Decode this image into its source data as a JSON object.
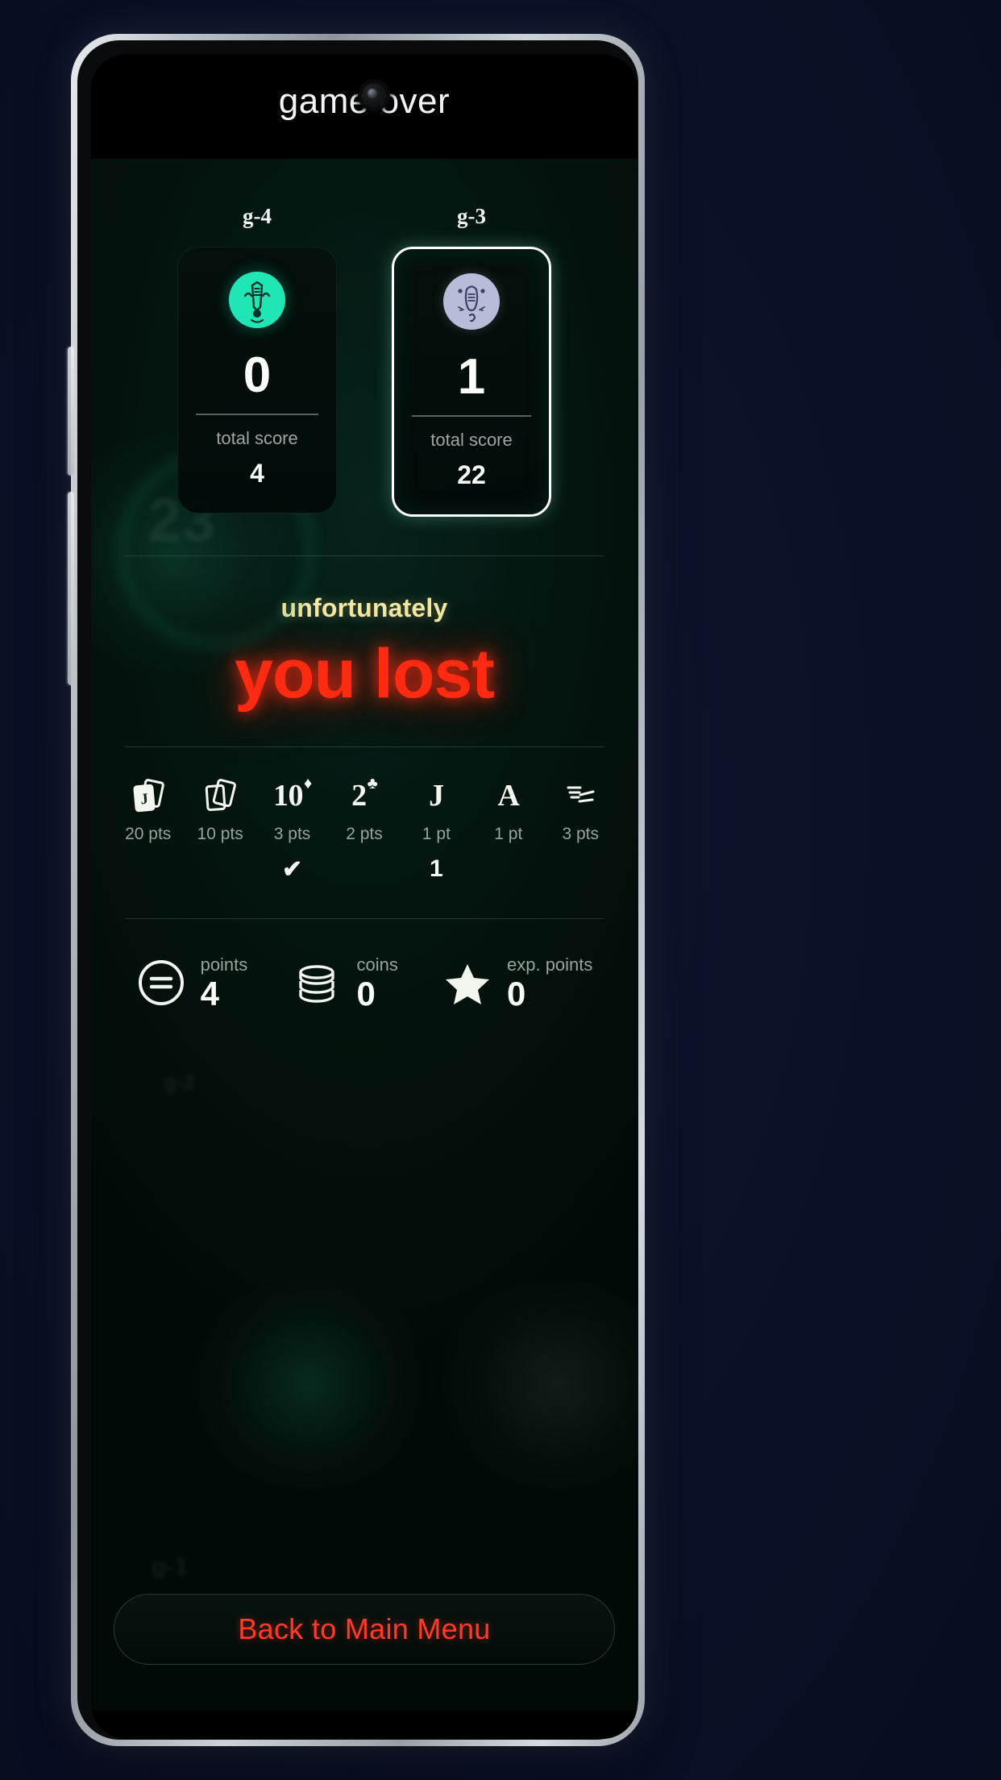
{
  "app": {
    "title": "game over",
    "camera_icon": "front-camera-cutout"
  },
  "players": [
    {
      "name": "g-4",
      "avatar_icon": "avatar-face-teal",
      "avatar_color": "#1FE6B4",
      "round_score": "0",
      "total_score_label": "total score",
      "total_score": "4",
      "active": false
    },
    {
      "name": "g-3",
      "avatar_icon": "avatar-face-lilac",
      "avatar_color": "#B9BCD8",
      "round_score": "1",
      "total_score_label": "total score",
      "total_score": "22",
      "active": true
    }
  ],
  "result": {
    "subtitle": "unfortunately",
    "headline": "you lost",
    "subtitle_color": "#F2E9A3",
    "headline_color": "#FF2A12"
  },
  "legend": {
    "columns": [
      {
        "icon": "two-cards-jack-icon",
        "rank": "",
        "suit": "",
        "points": "20 pts",
        "mark": ""
      },
      {
        "icon": "two-cards-blank-icon",
        "rank": "",
        "suit": "",
        "points": "10 pts",
        "mark": ""
      },
      {
        "icon": "card-rank-icon",
        "rank": "10",
        "suit": "♦",
        "points": "3 pts",
        "mark": "✔"
      },
      {
        "icon": "card-rank-icon",
        "rank": "2",
        "suit": "♣",
        "points": "2 pts",
        "mark": ""
      },
      {
        "icon": "card-rank-icon",
        "rank": "J",
        "suit": "",
        "points": "1 pt",
        "mark": "1"
      },
      {
        "icon": "card-rank-icon",
        "rank": "A",
        "suit": "",
        "points": "1 pt",
        "mark": ""
      },
      {
        "icon": "stacked-lines-icon",
        "rank": "",
        "suit": "",
        "points": "3 pts",
        "mark": ""
      }
    ]
  },
  "rewards": [
    {
      "icon": "points-equals-circle-icon",
      "label": "points",
      "value": "4"
    },
    {
      "icon": "coin-stack-icon",
      "label": "coins",
      "value": "0"
    },
    {
      "icon": "star-icon",
      "label": "exp. points",
      "value": "0"
    }
  ],
  "footer": {
    "back_button": "Back to Main Menu",
    "back_button_color": "#FF3B28"
  }
}
